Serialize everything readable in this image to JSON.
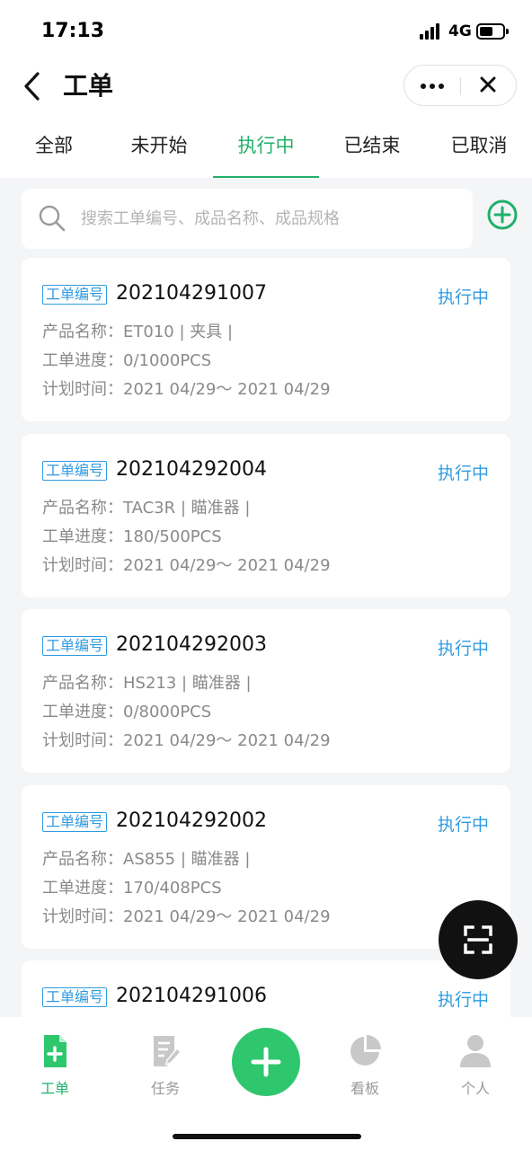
{
  "status_bar": {
    "time": "17:13",
    "network": "4G"
  },
  "header": {
    "title": "工单"
  },
  "tabs": [
    {
      "label": "全部"
    },
    {
      "label": "未开始"
    },
    {
      "label": "执行中"
    },
    {
      "label": "已结束"
    },
    {
      "label": "已取消"
    }
  ],
  "active_tab": "执行中",
  "search": {
    "placeholder": "搜索工单编号、成品名称、成品规格",
    "value": ""
  },
  "badge_label": "工单编号",
  "orders": [
    {
      "no": "202104291007",
      "status": "执行中",
      "product": "产品名称：ET010 | 夹具 |",
      "progress": "工单进度：0/1000PCS",
      "time": "计划时间：2021 04/29～ 2021 04/29"
    },
    {
      "no": "202104292004",
      "status": "执行中",
      "product": "产品名称：TAC3R | 瞄准器 |",
      "progress": "工单进度：180/500PCS",
      "time": "计划时间：2021 04/29～ 2021 04/29"
    },
    {
      "no": "202104292003",
      "status": "执行中",
      "product": "产品名称：HS213 | 瞄准器 |",
      "progress": "工单进度：0/8000PCS",
      "time": "计划时间：2021 04/29～ 2021 04/29"
    },
    {
      "no": "202104292002",
      "status": "执行中",
      "product": "产品名称：AS855 | 瞄准器 |",
      "progress": "工单进度：170/408PCS",
      "time": "计划时间：2021 04/29～ 2021 04/29"
    },
    {
      "no": "202104291006",
      "status": "执行中"
    }
  ],
  "bottom_nav": [
    {
      "label": "工单",
      "icon": "work-order-icon",
      "active": true
    },
    {
      "label": "任务",
      "icon": "task-icon",
      "active": false
    },
    {
      "label": "看板",
      "icon": "dashboard-pie-icon",
      "active": false
    },
    {
      "label": "个人",
      "icon": "person-icon",
      "active": false
    }
  ],
  "colors": {
    "accent_green": "#21b06a",
    "fab_green": "#2fc76e",
    "status_blue": "#2f9be0",
    "background": "#f4f5f7"
  }
}
